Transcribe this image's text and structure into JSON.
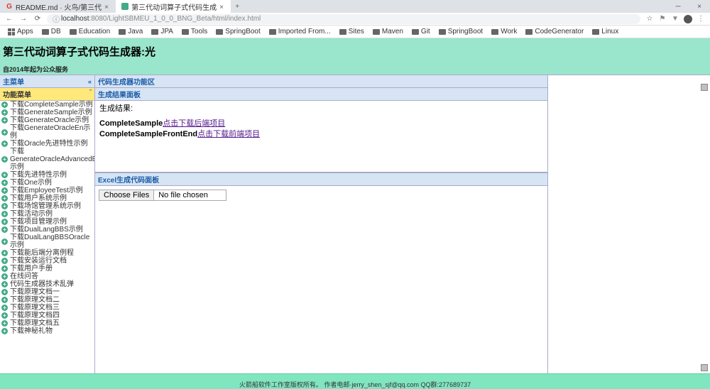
{
  "browser": {
    "tabs": [
      {
        "title": "README.md · 火鸟/第三代",
        "favicon_color": "#d33"
      },
      {
        "title": "第三代动词算子式代码生成",
        "favicon_color": "#4a8"
      }
    ],
    "url": {
      "secure": "ⓘ",
      "host": "localhost",
      "path": ":8080/LightSBMEU_1_0_0_BNG_Beta/html/index.html"
    },
    "bookmarks": [
      "Apps",
      "DB",
      "Education",
      "Java",
      "JPA",
      "Tools",
      "SpringBoot",
      "Imported From...",
      "Sites",
      "Maven",
      "Git",
      "SpringBoot",
      "Work",
      "CodeGenerator",
      "Linux"
    ]
  },
  "page": {
    "title": "第三代动词算子式代码生成器:光",
    "subtitle": "自2014年起为公众服务"
  },
  "sidebar": {
    "main_menu": "主菜单",
    "func_menu": "功能菜单",
    "items": [
      "下载CompleteSample示例",
      "下载GenerateSample示例",
      "下载GenerateOracle示例",
      "下载GenerateOracleEn示例",
      "下载Oracle先进特性示例",
      "下载GenerateOracleAdvancedEn示例",
      "下载先进特性示例",
      "下载One示例",
      "下载EmployeeTest示例",
      "下载用户系统示例",
      "下载场馆管理系统示例",
      "下载活动示例",
      "下载项目管理示例",
      "下载DualLangBBS示例",
      "下载DualLangBBSOracle示例",
      "下载能后端分离例程",
      "下载安装运行文档",
      "下载用户手册",
      "在线问答",
      "代码生成器技术乱弹",
      "下载原理文档一",
      "下载原理文档二",
      "下载原理文档三",
      "下载原理文档四",
      "下载原理文档五",
      "下载神秘礼物"
    ]
  },
  "main": {
    "func_area": "代码生成器功能区",
    "result_panel": "生成结果面板",
    "result_label": "生成结果:",
    "rows": [
      {
        "bold": "CompleteSample",
        "link": "点击下载后端项目"
      },
      {
        "bold": "CompleteSampleFrontEnd",
        "link": "点击下载前端项目"
      }
    ],
    "excel_panel": "Excel生成代码面板",
    "choose_files": "Choose Files",
    "no_file": "No file chosen"
  },
  "footer": "火箭船软件工作室版权所有。 作者电邮·jerry_shen_sjf@qq.com QQ群:277689737"
}
